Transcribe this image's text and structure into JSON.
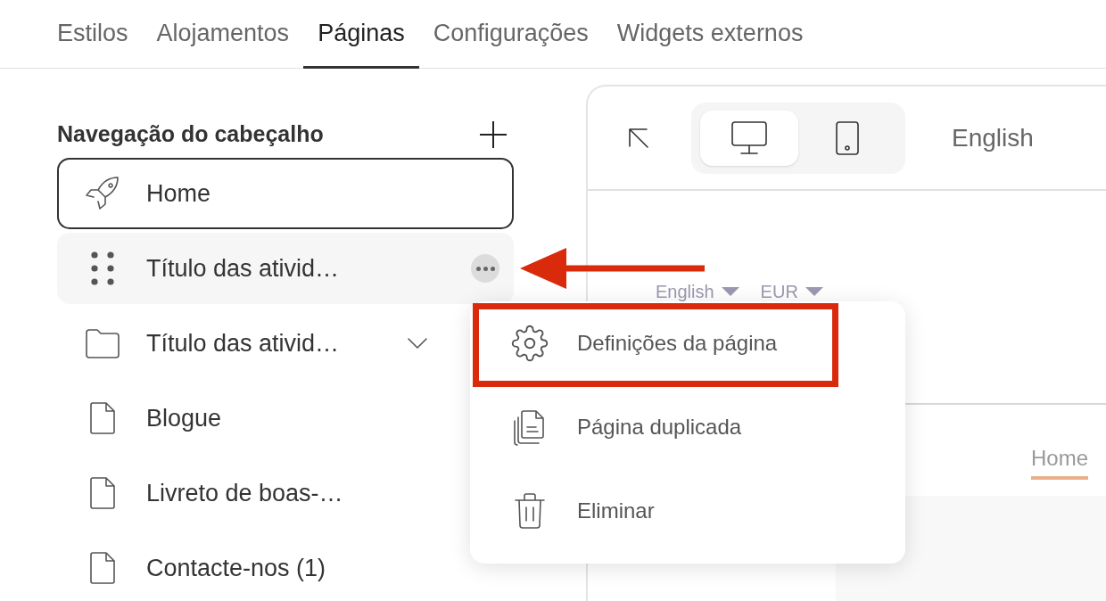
{
  "tabs": [
    {
      "label": "Estilos",
      "selected": false
    },
    {
      "label": "Alojamentos",
      "selected": false
    },
    {
      "label": "Páginas",
      "selected": true
    },
    {
      "label": "Configurações",
      "selected": false
    },
    {
      "label": "Widgets externos",
      "selected": false
    }
  ],
  "sidebar": {
    "title": "Navegação do cabeçalho",
    "items": [
      {
        "label": "Home",
        "kind": "home",
        "selected": true,
        "hovered": false
      },
      {
        "label": "Título das ativid…",
        "kind": "page",
        "selected": false,
        "hovered": true
      },
      {
        "label": "Título das ativid…",
        "kind": "folder",
        "selected": false,
        "hovered": false
      },
      {
        "label": "Blogue",
        "kind": "page",
        "selected": false,
        "hovered": false
      },
      {
        "label": "Livreto de boas-…",
        "kind": "page",
        "selected": false,
        "hovered": false
      },
      {
        "label": "Contacte-nos (1)",
        "kind": "page",
        "selected": false,
        "hovered": false
      }
    ]
  },
  "preview": {
    "devices": [
      {
        "kind": "desktop",
        "selected": true
      },
      {
        "kind": "mobile",
        "selected": false
      }
    ],
    "language": "English",
    "site_language": "English",
    "site_currency": "EUR",
    "nav_link": "Home"
  },
  "context_menu": {
    "items": [
      {
        "label": "Definições da página",
        "kind": "settings",
        "annotated": true
      },
      {
        "label": "Página duplicada",
        "kind": "duplicate",
        "annotated": false
      },
      {
        "label": "Eliminar",
        "kind": "delete",
        "annotated": false
      }
    ]
  }
}
